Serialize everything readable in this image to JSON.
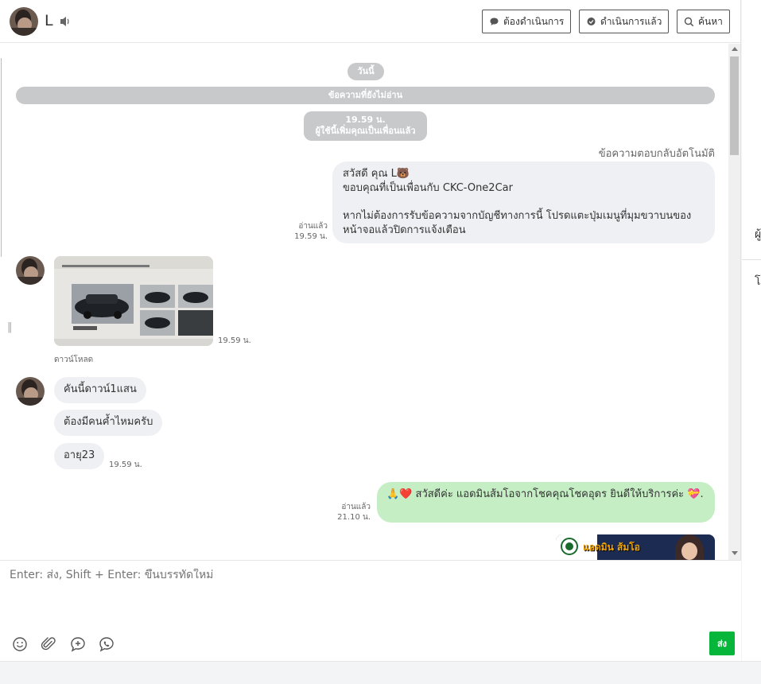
{
  "header": {
    "contact_name": "L",
    "buttons": {
      "todo": "ต้องดำเนินการ",
      "done": "ดำเนินการแล้ว",
      "search": "ค้นหา"
    }
  },
  "timeline": {
    "day_label": "วันนี้",
    "unread_label": "ข้อความที่ยังไม่อ่าน",
    "friend_time": "19.59 น.",
    "friend_text": "ผู้ใช้นี้เพิ่มคุณเป็นเพื่อนแล้ว",
    "autoreply_label": "ข้อความตอบกลับอัตโนมัติ"
  },
  "messages": {
    "auto_reply": {
      "line1": "สวัสดี คุณ L🐻",
      "line2": "ขอบคุณที่เป็นเพื่อนกับ CKC-One2Car",
      "line3": "หากไม่ต้องการรับข้อความจากบัญชีทางการนี้ โปรดแตะปุ่มเมนูที่มุมขวาบนของ",
      "line4": "หน้าจอแล้วปิดการแจ้งเตือน",
      "read_label": "อ่านแล้ว",
      "time": "19.59 น."
    },
    "image_msg": {
      "time": "19.59 น.",
      "download_label": "ดาวน์โหลด"
    },
    "text1": "คันนี้ดาวน์1แสน",
    "text2": "ต้องมีคนค้ำไหมครับ",
    "text3": "อายุ23",
    "text_time": "19.59 น.",
    "reply": {
      "text": "🙏❤️ สวัสดีค่ะ แอดมินส้มโอจากโชคคุณโชคอุดร ยินดีให้บริการค่ะ 💝.",
      "read_label": "อ่านแล้ว",
      "time": "21.10 น."
    },
    "banner_text": "แอดมิน ส้มโอ"
  },
  "composer": {
    "placeholder": "Enter: ส่ง, Shift + Enter: ขึ้นบรรทัดใหม่",
    "send_label": "ส่ง"
  },
  "right_panel": {
    "label1": "ผู้",
    "label2": "โ"
  },
  "colors": {
    "accent_green": "#06b63a",
    "bubble_green": "#c5eec4",
    "bubble_gray": "#eef0f3",
    "pill_gray": "#c8c9cb"
  }
}
